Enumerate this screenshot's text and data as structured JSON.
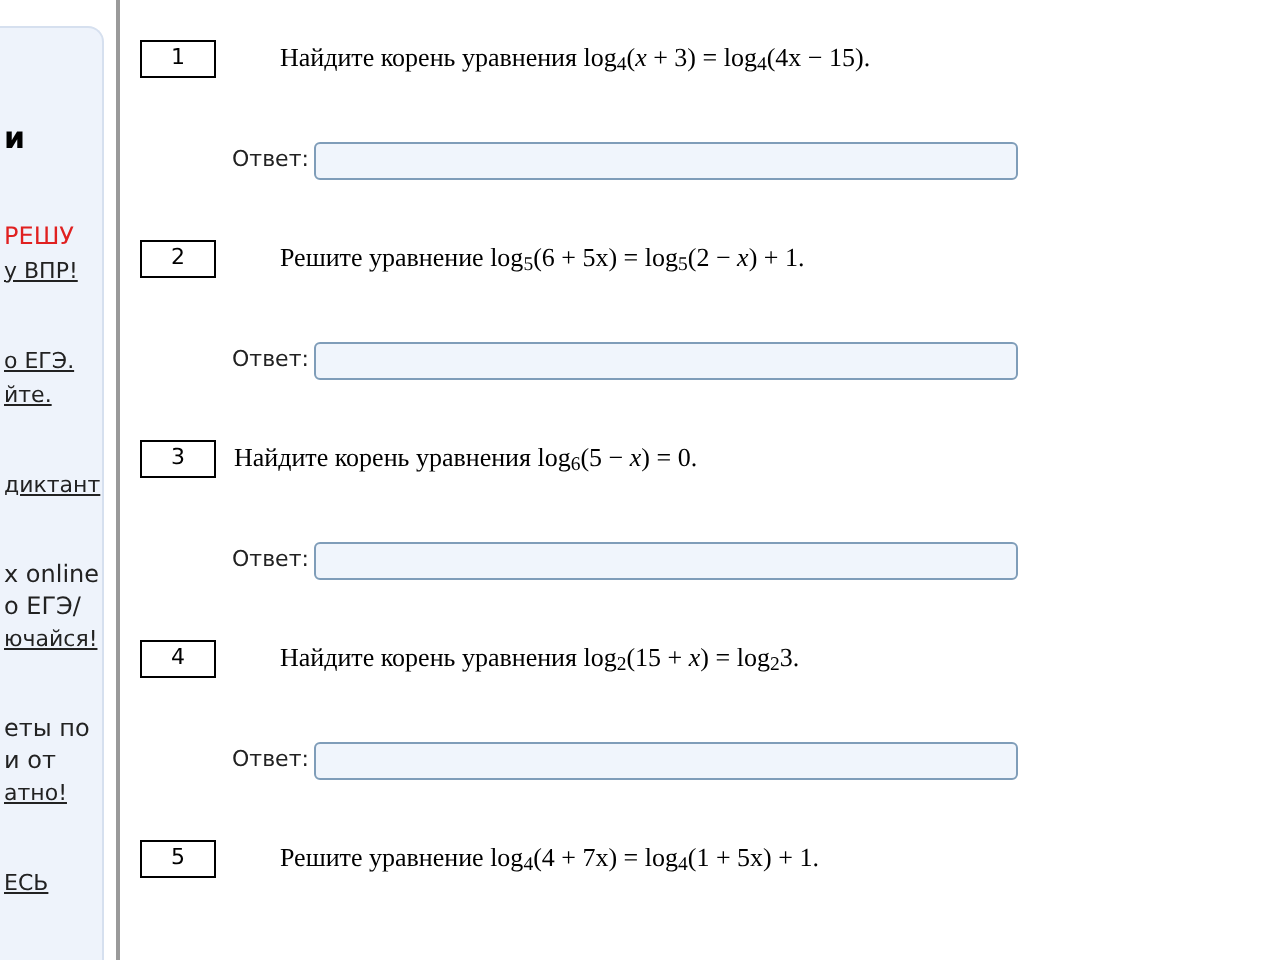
{
  "sidebar": {
    "blocks": [
      [
        {
          "kind": "heading",
          "text": "и"
        }
      ],
      [
        {
          "kind": "alert",
          "text": "РЕШУ"
        },
        {
          "kind": "link",
          "text": "у ВПР!"
        }
      ],
      [
        {
          "kind": "link",
          "text": "о ЕГЭ."
        },
        {
          "kind": "link",
          "text": "йте."
        }
      ],
      [
        {
          "kind": "link",
          "text": "диктант"
        }
      ],
      [
        {
          "kind": "text",
          "text": "х online"
        },
        {
          "kind": "text",
          "text": "о ЕГЭ/"
        },
        {
          "kind": "link",
          "text": "ючайся!"
        }
      ],
      [
        {
          "kind": "text",
          "text": "еты по"
        },
        {
          "kind": "text",
          "text": "и от"
        },
        {
          "kind": "link",
          "text": "атно!"
        }
      ],
      [
        {
          "kind": "link",
          "text": "ЕСЬ"
        }
      ]
    ]
  },
  "problems": [
    {
      "number": "1",
      "indented": true,
      "text": "Найдите корень уравнения  log$_{4}$(*x* + 3) = log$_{4}$(4x − 15).",
      "answer_label": "Ответ:"
    },
    {
      "number": "2",
      "indented": true,
      "text": "Решите уравнение  log$_{5}$(6 + 5x) = log$_{5}$(2 − *x*) + 1.",
      "answer_label": "Ответ:"
    },
    {
      "number": "3",
      "indented": false,
      "text": "Найдите корень уравнения  log$_{6}$(5 − *x*) = 0.",
      "answer_label": "Ответ:"
    },
    {
      "number": "4",
      "indented": true,
      "text": "Найдите корень уравнения  log$_{2}$(15 + *x*) = log$_{2}$3.",
      "answer_label": "Ответ:"
    },
    {
      "number": "5",
      "indented": true,
      "text": "Решите уравнение  log$_{4}$(4 + 7x) = log$_{4}$(1 + 5x) + 1."
    }
  ]
}
